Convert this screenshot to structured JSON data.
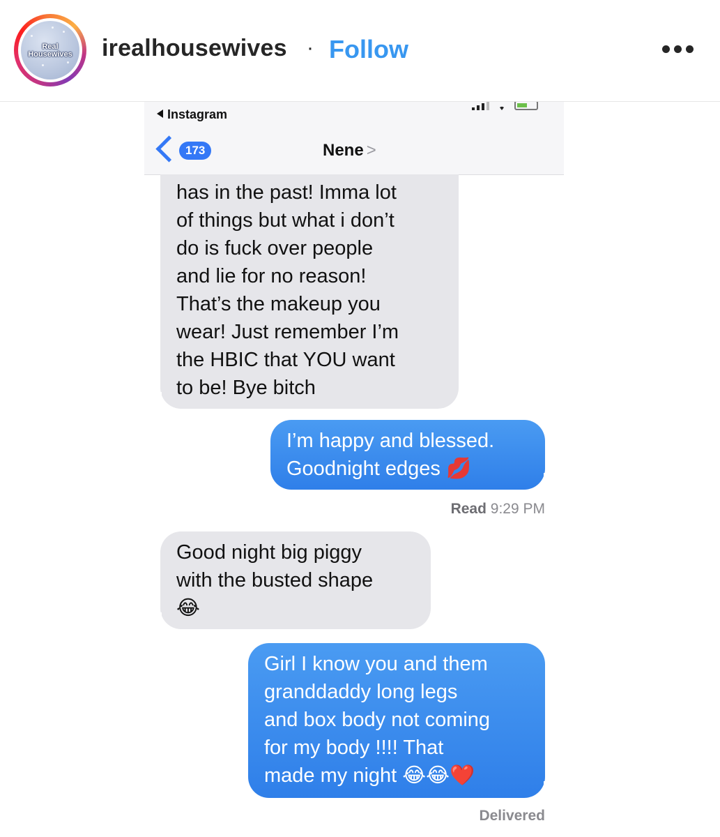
{
  "post": {
    "username": "irealhousewives",
    "separator": "·",
    "follow_label": "Follow",
    "avatar_logo_line1": "Real",
    "avatar_logo_line2": "Housewives",
    "more_icon": "more-horizontal-icon"
  },
  "phone": {
    "back_app_label": "Instagram",
    "unread_count": "173",
    "contact_name": "Nene",
    "contact_chevron": ">"
  },
  "messages": [
    {
      "direction": "incoming",
      "text": "has in the past! Imma lot\nof things but what i don’t\ndo is fuck over people\nand lie for no reason!\nThat’s the makeup you\nwear! Just remember I’m\nthe HBIC that YOU want\nto be! Bye bitch"
    },
    {
      "direction": "outgoing",
      "text": "I’m happy and blessed.\nGoodnight edges 💋"
    },
    {
      "direction": "incoming",
      "text": "Good night big piggy\nwith the busted shape\n😂"
    },
    {
      "direction": "outgoing",
      "text": "Girl I know you and them\ngranddaddy long legs\nand box body not coming\nfor my body !!!! That\nmade my night 😂😂❤️"
    }
  ],
  "receipts": {
    "read_label": "Read",
    "read_time": "9:29 PM",
    "delivered": "Delivered"
  },
  "colors": {
    "accent": "#3897f0",
    "imessage_blue": "#3478f6",
    "incoming_bubble": "#e6e6ea"
  }
}
